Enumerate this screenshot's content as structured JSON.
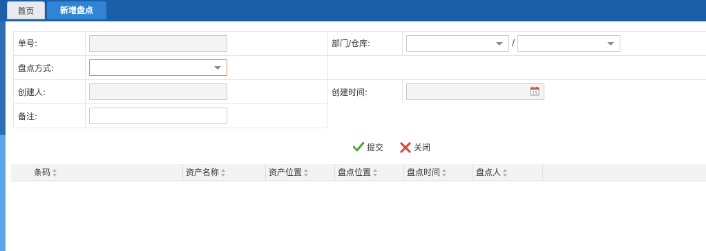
{
  "tabs": {
    "home": "首页",
    "active": "新增盘点"
  },
  "form": {
    "order_no_label": "单号:",
    "order_no_value": "",
    "dept_warehouse_label": "部门/仓库:",
    "dept_value": "",
    "warehouse_value": "",
    "separator": "/",
    "method_label": "盘点方式:",
    "method_value": "",
    "creator_label": "创建人:",
    "creator_value": "",
    "created_time_label": "创建时间:",
    "created_time_value": "",
    "remark_label": "备注:",
    "remark_value": "",
    "calendar_day": "15"
  },
  "actions": {
    "submit": "提交",
    "close": "关闭",
    "submit_icon_color": "#4ea72e",
    "close_icon_color": "#e2453a"
  },
  "table": {
    "columns": [
      "条码",
      "资产名称",
      "资产位置",
      "盘点位置",
      "盘点时间",
      "盘点人"
    ]
  },
  "colors": {
    "topbar": "#1a5fa8",
    "active_tab": "#2f84d6",
    "focus_border": "#e0962a"
  }
}
